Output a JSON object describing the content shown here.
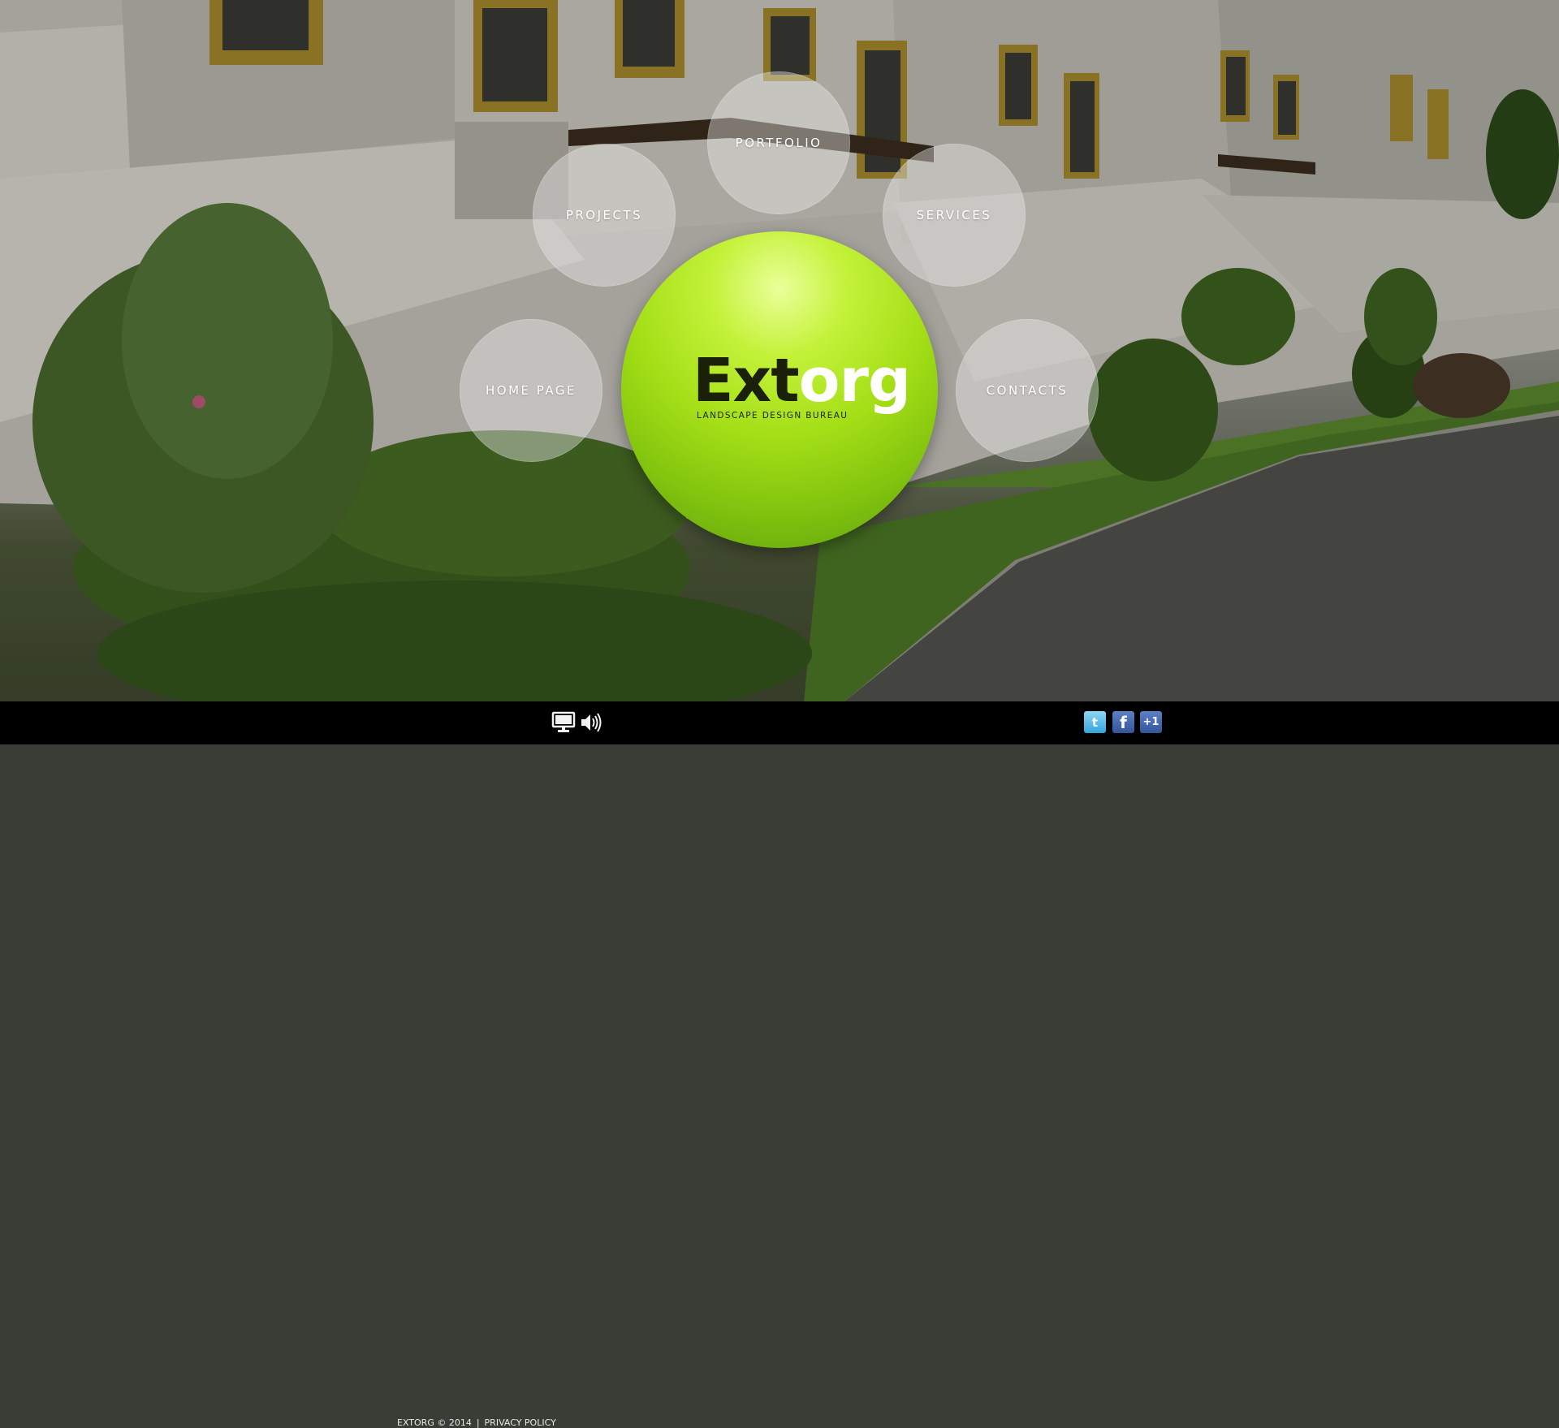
{
  "brand": {
    "logo_dark": "Ext",
    "logo_light": "org",
    "tagline": "LANDSCAPE DESIGN BUREAU"
  },
  "navigation": {
    "portfolio": "PORTFOLIO",
    "projects": "PROJECTS",
    "services": "SERVICES",
    "home": "HOME PAGE",
    "contacts": "CONTACTS"
  },
  "footer": {
    "copyright": "EXTORG © 2014",
    "separator": "|",
    "privacy": "PRIVACY POLICY"
  },
  "icons": {
    "monitor": "monitor-icon",
    "sound": "speaker-icon",
    "twitter": "twitter-icon",
    "facebook": "facebook-icon",
    "plus_one": "google-plus-one-icon"
  },
  "social_labels": {
    "twitter": "t",
    "facebook": "f",
    "plus_one": "+1"
  },
  "colors": {
    "logo_ball": "#a5df17",
    "footer_bg": "#000000",
    "bubble": "rgba(235,235,235,0.42)"
  }
}
